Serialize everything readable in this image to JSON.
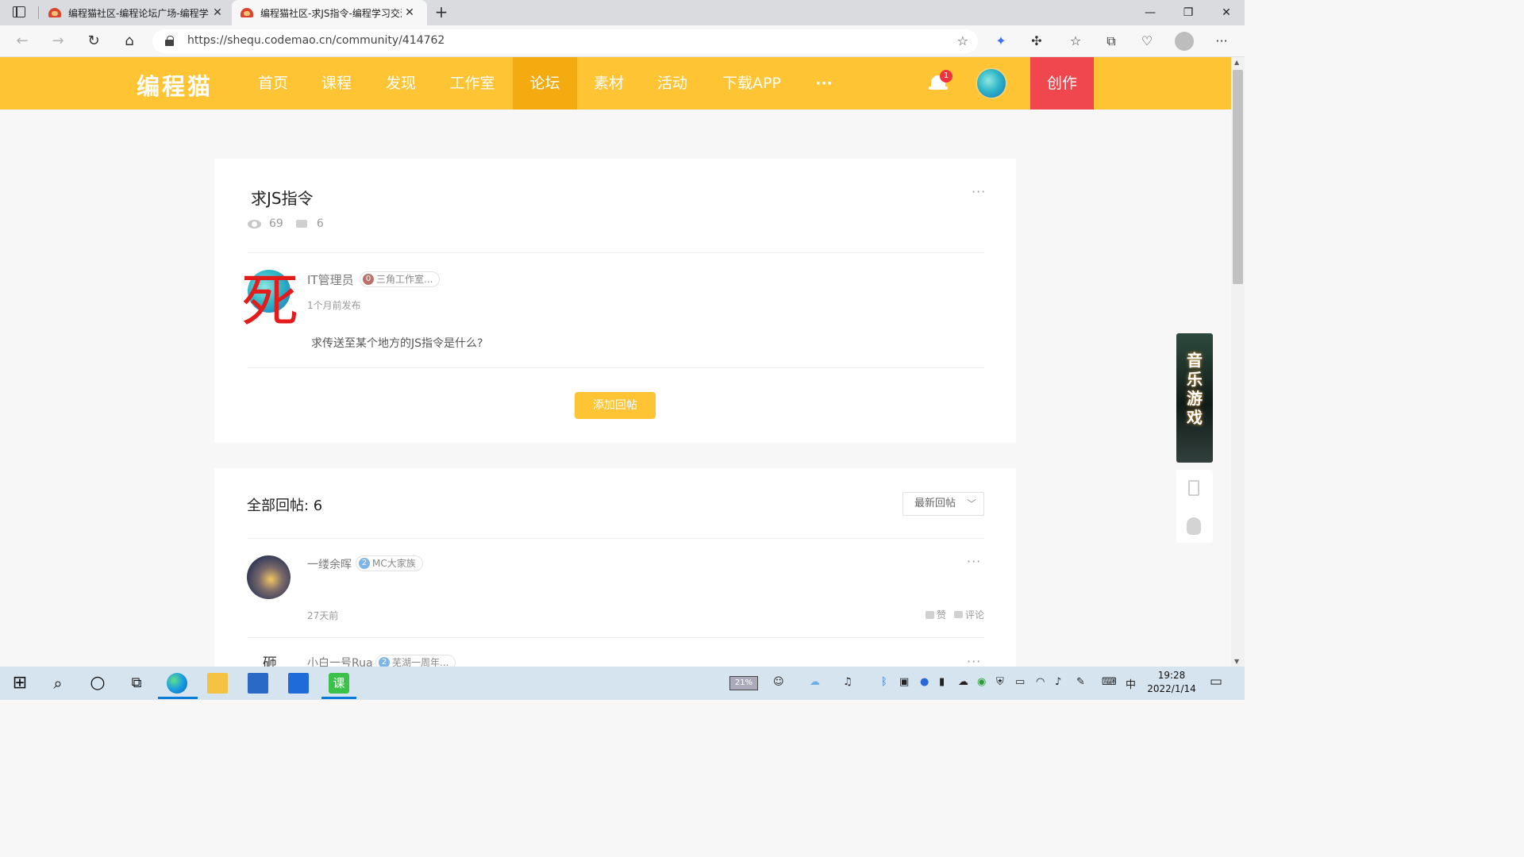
{
  "browser": {
    "tabs": [
      {
        "title": "编程猫社区-编程论坛广场-编程学习",
        "close": "✕"
      },
      {
        "title": "编程猫社区-求JS指令-编程学习交流",
        "close": "✕"
      }
    ],
    "new_tab": "+",
    "url": "https://shequ.codemao.cn/community/414762"
  },
  "site": {
    "logo": "编程猫",
    "nav": [
      "首页",
      "课程",
      "发现",
      "工作室",
      "论坛",
      "素材",
      "活动",
      "下载APP",
      "···"
    ],
    "active_nav": "论坛",
    "notification_count": "1",
    "create_label": "创作",
    "colors": {
      "brand_yellow": "#fec433",
      "active_yellow": "#f4ab0f",
      "create_red": "#f0474f"
    }
  },
  "post": {
    "title": "求JS指令",
    "views": "69",
    "comments": "6",
    "more": "···",
    "author": {
      "name": "IT管理员",
      "level": "0",
      "tag": "三角工作室..."
    },
    "overlay_char": "死",
    "time": "1个月前发布",
    "body": "求传送至某个地方的JS指令是什么?",
    "add_reply_label": "添加回帖"
  },
  "replies": {
    "title": "全部回帖: 6",
    "sort_label": "最新回帖",
    "items": [
      {
        "name": "一缕余晖",
        "level": "2",
        "tag": "MC大家族",
        "time": "27天前",
        "like_label": "赞",
        "comment_label": "评论",
        "more": "···"
      },
      {
        "name": "小白一号Rua",
        "level": "2",
        "tag": "芜湖一周年...",
        "avatar_char": "砸",
        "more": "···"
      }
    ]
  },
  "float": {
    "ad_text": "音乐游戏"
  },
  "taskbar": {
    "battery": "21%",
    "ime": "中",
    "time": "19:28",
    "date": "2022/1/14"
  }
}
